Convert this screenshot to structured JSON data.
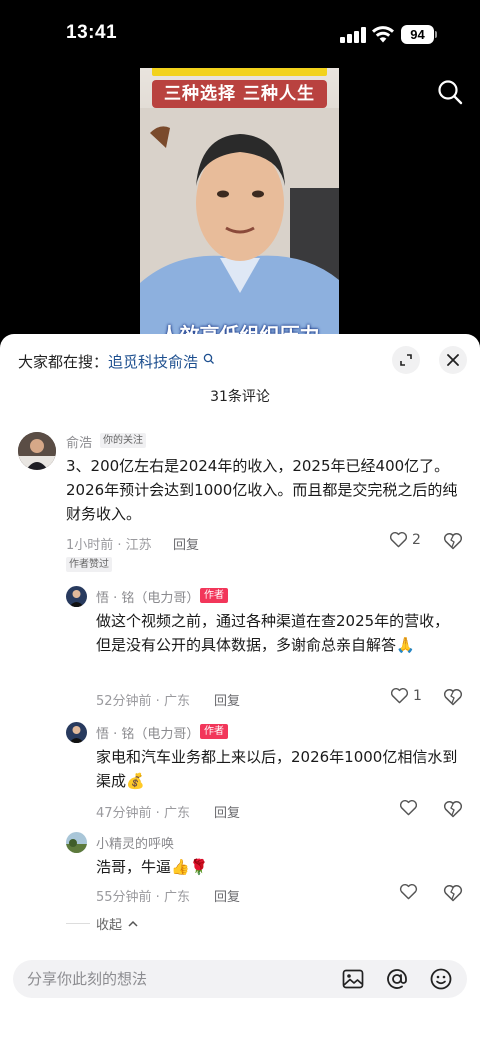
{
  "status": {
    "time": "13:41",
    "battery": "94"
  },
  "video": {
    "caption": "三种选择 三种人生",
    "subtitle": "人效高低组织压力"
  },
  "sheet": {
    "search_prefix": "大家都在搜：",
    "search_keyword": "追觅科技俞浩",
    "comment_count": "31条评论"
  },
  "comments": [
    {
      "name": "俞浩",
      "tag": "你的关注",
      "text": "3、200亿左右是2024年的收入，2025年已经400亿了。2026年预计会达到1000亿收入。而且都是交完税之后的纯财务收入。",
      "meta": "1小时前 · 江苏",
      "reply": "回复",
      "likes": "2",
      "liked_by_author": "作者赞过"
    },
    {
      "name": "悟 · 铭（电力哥）",
      "tag": "作者",
      "text": "做这个视频之前，通过各种渠道在查2025年的营收，但是没有公开的具体数据，多谢俞总亲自解答🙏",
      "meta": "52分钟前 · 广东",
      "reply": "回复",
      "likes": "1"
    },
    {
      "name": "悟 · 铭（电力哥）",
      "tag": "作者",
      "text": "家电和汽车业务都上来以后，2026年1000亿相信水到渠成💰",
      "meta": "47分钟前 · 广东",
      "reply": "回复",
      "likes": ""
    },
    {
      "name": "小精灵的呼唤",
      "text": "浩哥，牛逼👍🌹",
      "meta": "55分钟前 · 广东",
      "reply": "回复",
      "likes": ""
    }
  ],
  "collapse_label": "收起",
  "input": {
    "placeholder": "分享你此刻的想法"
  },
  "icons": [
    "search-icon",
    "expand-icon",
    "close-icon",
    "heart-icon",
    "dislike-heart-icon",
    "image-icon",
    "at-icon",
    "emoji-icon",
    "chevron-up-icon"
  ],
  "colors": {
    "author_tag": "#f2365a",
    "keyword": "#1d4f8f",
    "video_caption_bg": "#b9423f"
  }
}
